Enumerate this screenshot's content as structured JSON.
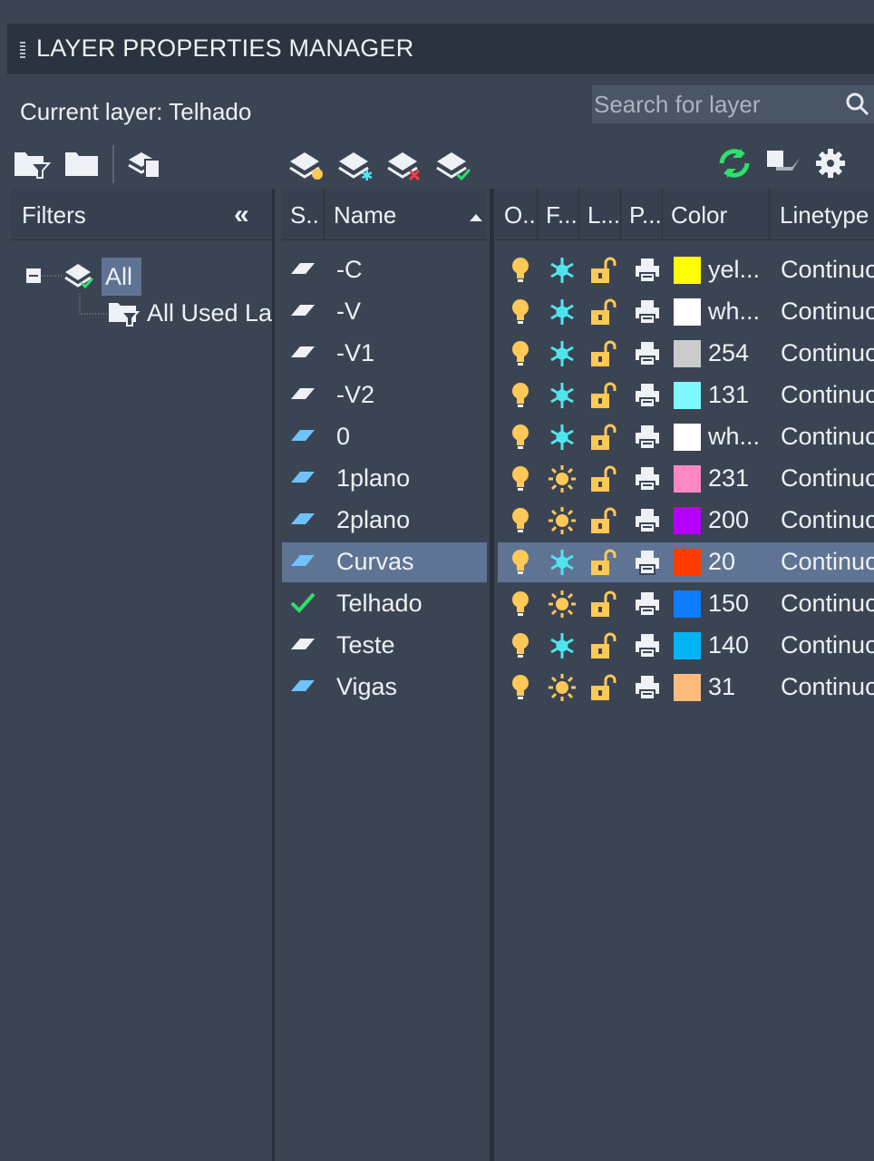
{
  "window": {
    "title": "LAYER PROPERTIES MANAGER"
  },
  "current_layer": {
    "label": "Current layer: Telhado"
  },
  "search": {
    "placeholder": "Search for layer"
  },
  "filters": {
    "header": "Filters",
    "collapse_icon": "double-chevron-left-icon",
    "tree": {
      "root": "All",
      "child": "All Used Layers"
    }
  },
  "columns": {
    "status": "S...",
    "name": "Name",
    "on": "O..",
    "freeze": "F...",
    "lock": "L...",
    "plot": "P...",
    "color": "Color",
    "linetype": "Linetype"
  },
  "layers": [
    {
      "status": "white",
      "name": "-C",
      "freeze": "snowflake",
      "color_hex": "#ffff00",
      "color_label": "yel...",
      "linetype": "Continuous"
    },
    {
      "status": "white",
      "name": "-V",
      "freeze": "snowflake",
      "color_hex": "#ffffff",
      "color_label": "wh...",
      "linetype": "Continuous"
    },
    {
      "status": "white",
      "name": "-V1",
      "freeze": "snowflake",
      "color_hex": "#cbcbcb",
      "color_label": "254",
      "linetype": "Continuous"
    },
    {
      "status": "white",
      "name": "-V2",
      "freeze": "snowflake",
      "color_hex": "#7ff9ff",
      "color_label": "131",
      "linetype": "Continuous"
    },
    {
      "status": "blue",
      "name": "0",
      "freeze": "snowflake",
      "color_hex": "#ffffff",
      "color_label": "wh...",
      "linetype": "Continuous"
    },
    {
      "status": "blue",
      "name": "1plano",
      "freeze": "sun",
      "color_hex": "#ff88c4",
      "color_label": "231",
      "linetype": "Continuous"
    },
    {
      "status": "blue",
      "name": "2plano",
      "freeze": "sun",
      "color_hex": "#b400ff",
      "color_label": "200",
      "linetype": "Continuous"
    },
    {
      "status": "blue",
      "name": "Curvas",
      "freeze": "snowflake",
      "color_hex": "#ff3b00",
      "color_label": "20",
      "linetype": "Continuous",
      "selected": true
    },
    {
      "status": "check",
      "name": "Telhado",
      "freeze": "sun",
      "color_hex": "#0f7dff",
      "color_label": "150",
      "linetype": "Continuous"
    },
    {
      "status": "white",
      "name": "Teste",
      "freeze": "snowflake",
      "color_hex": "#00b4f6",
      "color_label": "140",
      "linetype": "Continuous"
    },
    {
      "status": "blue",
      "name": "Vigas",
      "freeze": "sun",
      "color_hex": "#ffbb7c",
      "color_label": "31",
      "linetype": "Continuous"
    }
  ],
  "colors": {
    "panel": "#3b4453",
    "titlebar": "#2b3340",
    "selection": "#5f7494",
    "icon_yellow": "#ffc857",
    "icon_cyan": "#4fe6ee",
    "refresh_green": "#2ee06a"
  }
}
